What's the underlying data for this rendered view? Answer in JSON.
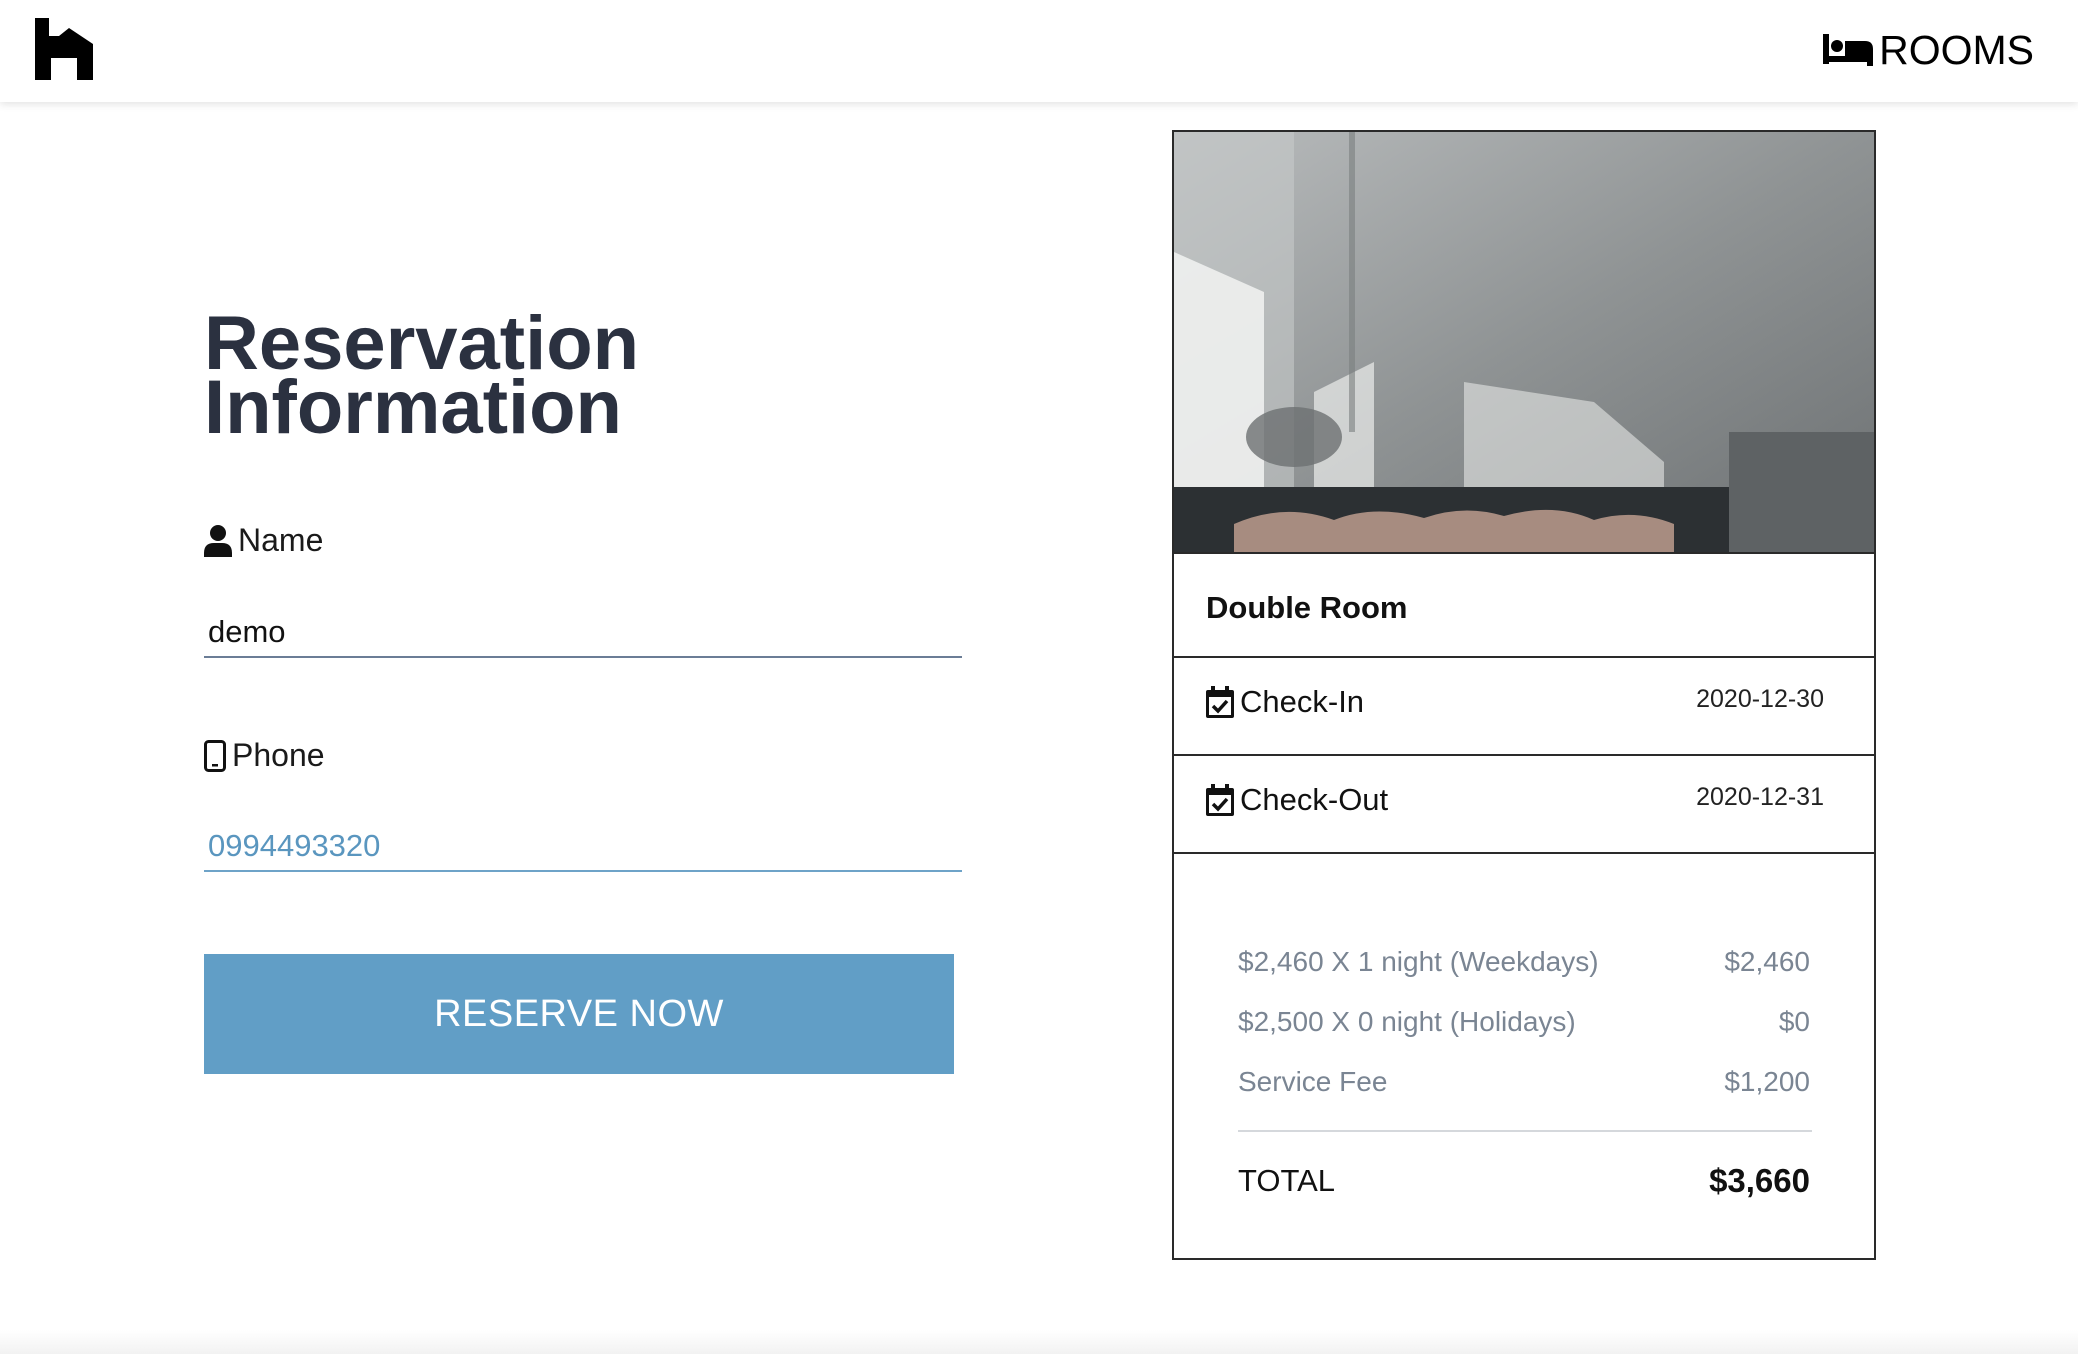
{
  "header": {
    "logo_icon": "hotel-h-logo",
    "rooms_icon": "bed-icon",
    "rooms_label": "ROOMS"
  },
  "form": {
    "title_line1": "Reservation",
    "title_line2": "Information",
    "name_icon": "user-icon",
    "name_label": "Name",
    "name_value": "demo",
    "phone_icon": "mobile-phone-icon",
    "phone_label": "Phone",
    "phone_value": "0994493320",
    "submit_label": "RESERVE NOW",
    "accent_color": "#619ec6"
  },
  "summary": {
    "room_name": "Double Room",
    "check_in_label": "Check-In",
    "check_in_date": "2020-12-30",
    "check_out_label": "Check-Out",
    "check_out_date": "2020-12-31",
    "calendar_icon": "calendar-check-icon",
    "price_lines": [
      {
        "label": "$2,460 X 1 night (Weekdays)",
        "amount": "$2,460"
      },
      {
        "label": "$2,500 X 0 night (Holidays)",
        "amount": "$0"
      },
      {
        "label": "Service Fee",
        "amount": "$1,200"
      }
    ],
    "total_label": "TOTAL",
    "total_amount": "$3,660"
  }
}
